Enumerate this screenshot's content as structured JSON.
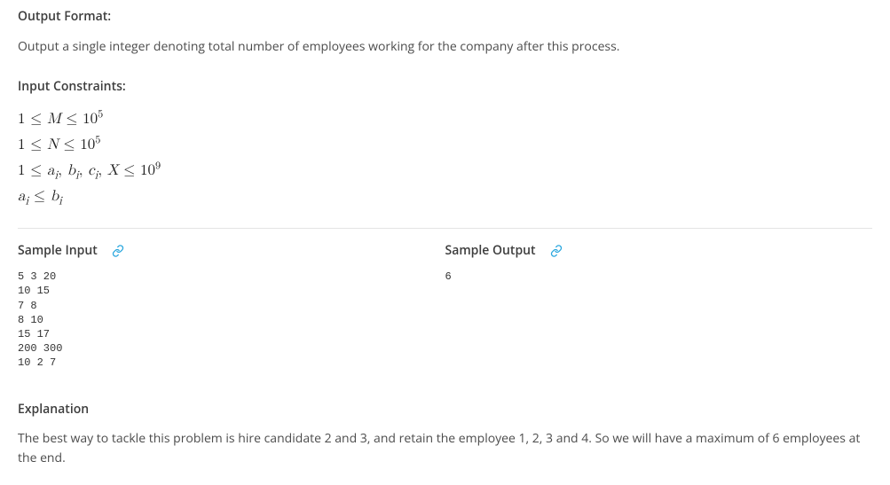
{
  "output_format": {
    "heading": "Output Format:",
    "text": "Output a single integer denoting total number of employees working for the company after this process."
  },
  "input_constraints": {
    "heading": "Input Constraints:",
    "lines": [
      "1 ≤ M ≤ 10^5",
      "1 ≤ N ≤ 10^5",
      "1 ≤ a_i, b_i, c_i, X ≤ 10^9",
      "a_i ≤ b_i"
    ]
  },
  "sample": {
    "input_label": "Sample Input",
    "output_label": "Sample Output",
    "input": "5 3 20\n10 15\n7 8\n8 10\n15 17\n200 300\n10 2 7",
    "output": "6"
  },
  "explanation": {
    "heading": "Explanation",
    "text": "The best way to tackle this problem is hire candidate 2 and 3, and retain the employee 1, 2, 3 and 4. So we will have a maximum of 6 employees at the end."
  },
  "icons": {
    "link": "link-icon"
  }
}
